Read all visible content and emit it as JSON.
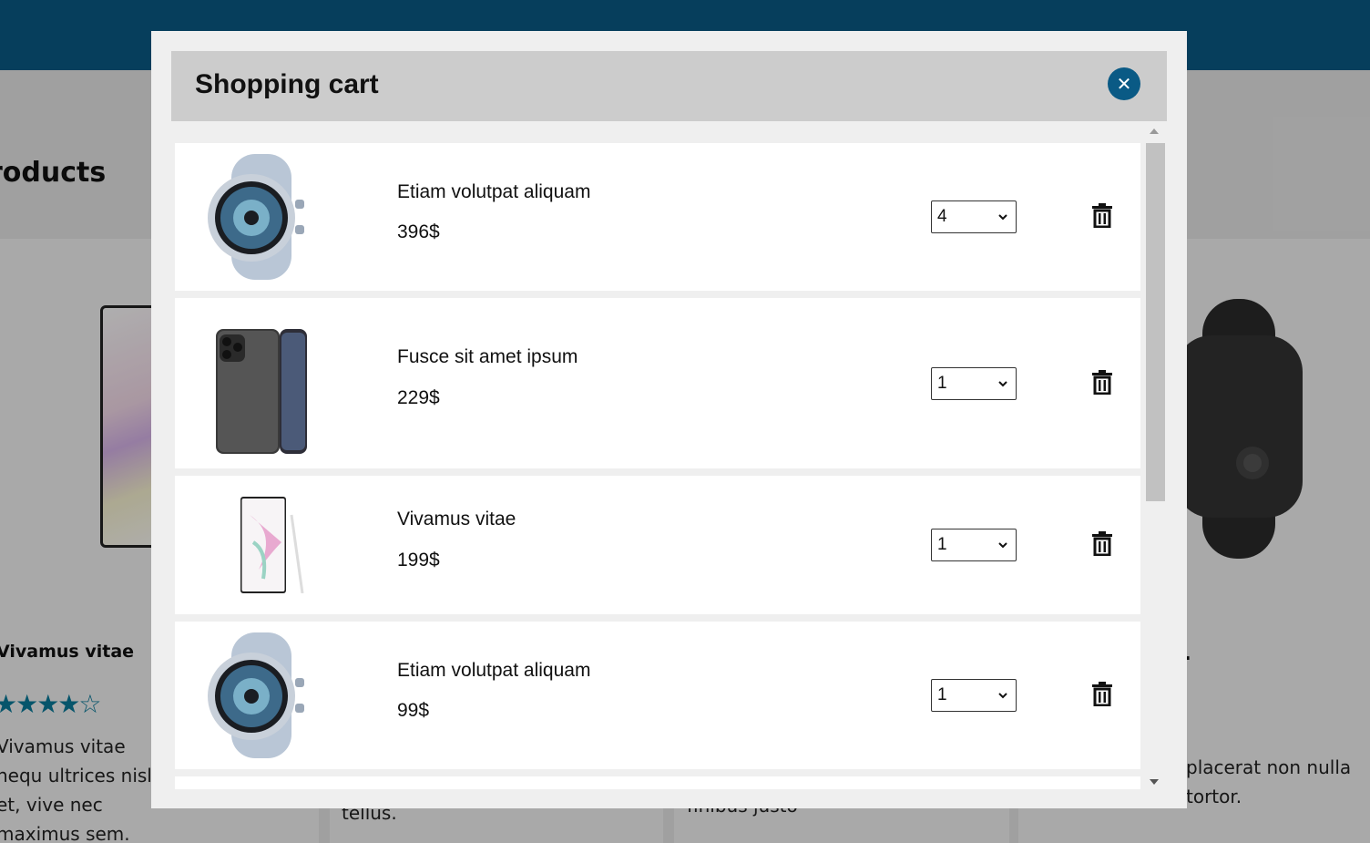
{
  "background": {
    "section_title": "roducts",
    "product_name": "Vivamus vitae",
    "rating_stars": "★★★★☆",
    "desc1": "Vivamus vitae nequ ultrices nisl et, vive nec maximus sem.",
    "desc2": "tellus.",
    "desc3": "finibus justo",
    "desc4": "placerat non nulla tortor.",
    "dot": "."
  },
  "modal": {
    "title": "Shopping cart",
    "close_label": "✕"
  },
  "cart": {
    "items": [
      {
        "name": "Etiam volutpat aliquam",
        "price": "396$",
        "quantity": "4",
        "image": "smartwatch-silver"
      },
      {
        "name": "Fusce sit amet ipsum",
        "price": "229$",
        "quantity": "1",
        "image": "smartphone-iphone"
      },
      {
        "name": "Vivamus vitae",
        "price": "199$",
        "quantity": "1",
        "image": "smartphone-note"
      },
      {
        "name": "Etiam volutpat aliquam",
        "price": "99$",
        "quantity": "1",
        "image": "smartwatch-silver"
      }
    ]
  },
  "colors": {
    "brand": "#0a5a85",
    "header_bg": "#cccccc",
    "modal_bg": "#efefef"
  },
  "icons": {
    "close": "close-icon",
    "delete": "trash-icon",
    "dropdown": "chevron-down-icon"
  }
}
